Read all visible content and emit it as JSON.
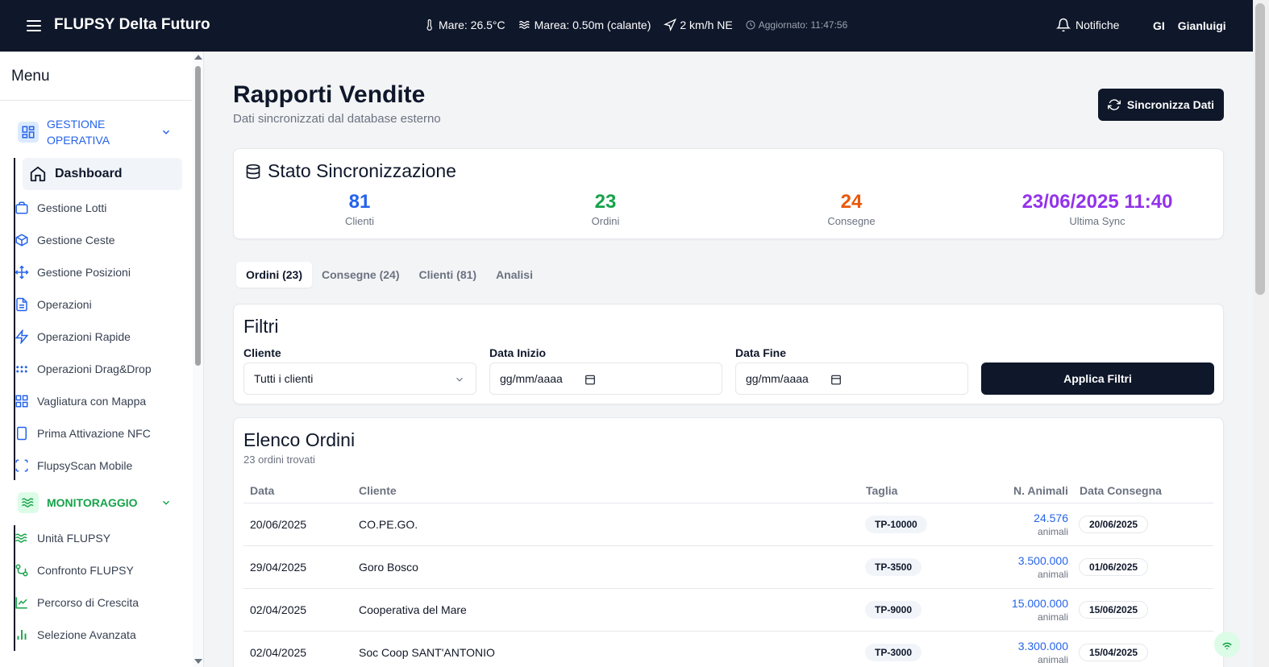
{
  "header": {
    "title": "FLUPSY Delta Futuro",
    "weather": {
      "sea_temp": "Mare: 26.5°C",
      "tide": "Marea: 0.50m (calante)",
      "wind": "2 km/h NE",
      "updated": "Aggiornato: 11:47:56"
    },
    "notifications_label": "Notifiche",
    "user_initials": "GI",
    "user_name": "Gianluigi"
  },
  "sidebar": {
    "title": "Menu",
    "sections": [
      {
        "label": "GESTIONE OPERATIVA",
        "icon": "grid-icon",
        "items": [
          {
            "label": "Dashboard",
            "icon": "home-icon"
          },
          {
            "label": "Gestione Lotti",
            "icon": "box-icon"
          },
          {
            "label": "Gestione Ceste",
            "icon": "package-icon"
          },
          {
            "label": "Gestione Posizioni",
            "icon": "move-icon"
          },
          {
            "label": "Operazioni",
            "icon": "file-text-icon"
          },
          {
            "label": "Operazioni Rapide",
            "icon": "lightning-icon"
          },
          {
            "label": "Operazioni Drag&Drop",
            "icon": "grip-icon"
          },
          {
            "label": "Vagliatura con Mappa",
            "icon": "layout-grid-icon"
          },
          {
            "label": "Prima Attivazione NFC",
            "icon": "smartphone-icon"
          },
          {
            "label": "FlupsyScan Mobile",
            "icon": "scan-icon"
          }
        ]
      },
      {
        "label": "MONITORAGGIO",
        "icon": "waves-icon",
        "items": [
          {
            "label": "Unità FLUPSY",
            "icon": "waves-icon"
          },
          {
            "label": "Confronto FLUPSY",
            "icon": "git-compare-icon"
          },
          {
            "label": "Percorso di Crescita",
            "icon": "line-chart-icon"
          },
          {
            "label": "Selezione Avanzata",
            "icon": "bar-chart-icon"
          }
        ]
      }
    ]
  },
  "page": {
    "title": "Rapporti Vendite",
    "subtitle": "Dati sincronizzati dal database esterno",
    "sync_button": "Sincronizza Dati"
  },
  "sync_status": {
    "title": "Stato Sincronizzazione",
    "stats": [
      {
        "value": "81",
        "label": "Clienti",
        "color": "#2563eb"
      },
      {
        "value": "23",
        "label": "Ordini",
        "color": "#16a34a"
      },
      {
        "value": "24",
        "label": "Consegne",
        "color": "#ea580c"
      },
      {
        "value": "23/06/2025 11:40",
        "label": "Ultima Sync",
        "color": "#9333ea"
      }
    ]
  },
  "tabs": [
    "Ordini (23)",
    "Consegne (24)",
    "Clienti (81)",
    "Analisi"
  ],
  "filters": {
    "title": "Filtri",
    "client_label": "Cliente",
    "client_value": "Tutti i clienti",
    "start_label": "Data Inizio",
    "start_placeholder": "gg/mm/aaaa",
    "end_label": "Data Fine",
    "end_placeholder": "gg/mm/aaaa",
    "apply_button": "Applica Filtri"
  },
  "orders": {
    "title": "Elenco Ordini",
    "count": "23 ordini trovati",
    "columns": [
      "Data",
      "Cliente",
      "Taglia",
      "N. Animali",
      "Data Consegna"
    ],
    "unit": "animali",
    "rows": [
      {
        "date": "20/06/2025",
        "client": "CO.PE.GO.",
        "size": "TP-10000",
        "animals": "24.576",
        "delivery": "20/06/2025"
      },
      {
        "date": "29/04/2025",
        "client": "Goro Bosco",
        "size": "TP-3500",
        "animals": "3.500.000",
        "delivery": "01/06/2025"
      },
      {
        "date": "02/04/2025",
        "client": "Cooperativa del Mare",
        "size": "TP-9000",
        "animals": "15.000.000",
        "delivery": "15/06/2025"
      },
      {
        "date": "02/04/2025",
        "client": "Soc Coop SANT'ANTONIO",
        "size": "TP-3000",
        "animals": "3.300.000",
        "delivery": "15/04/2025"
      }
    ]
  }
}
